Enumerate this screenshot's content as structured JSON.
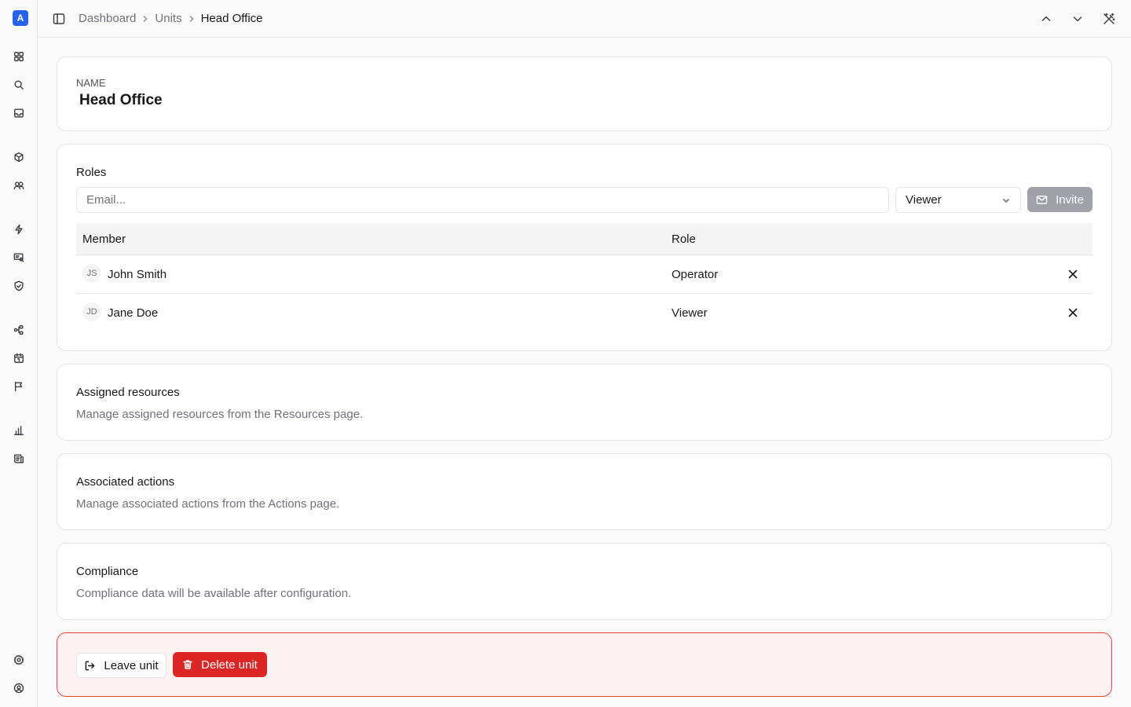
{
  "app": {
    "logo_letter": "A",
    "brand_color": "#2563eb"
  },
  "sidebar": {
    "icons": [
      "dashboard-icon",
      "search-icon",
      "inbox-icon",
      "cube-icon",
      "users-icon",
      "bolt-icon",
      "monitor-icon",
      "shield-icon",
      "workflow-icon",
      "calendar-icon",
      "flag-icon",
      "chart-icon",
      "report-icon",
      "settings-icon",
      "account-icon"
    ]
  },
  "header": {
    "breadcrumb": [
      "Dashboard",
      "Units",
      "Head Office"
    ]
  },
  "name_card": {
    "label": "NAME",
    "value": "Head Office"
  },
  "roles": {
    "title": "Roles",
    "email_placeholder": "Email...",
    "selected_role": "Viewer",
    "invite_label": "Invite",
    "columns": {
      "member": "Member",
      "role": "Role"
    },
    "members": [
      {
        "initials": "JS",
        "name": "John Smith",
        "role": "Operator"
      },
      {
        "initials": "JD",
        "name": "Jane Doe",
        "role": "Viewer"
      }
    ]
  },
  "resources": {
    "title": "Assigned resources",
    "description": "Manage assigned resources from the Resources page."
  },
  "actions": {
    "title": "Associated actions",
    "description": "Manage associated actions from the Actions page."
  },
  "compliance": {
    "title": "Compliance",
    "description": "Compliance data will be available after configuration."
  },
  "danger": {
    "leave_label": "Leave unit",
    "delete_label": "Delete unit",
    "danger_color": "#dc2626"
  }
}
